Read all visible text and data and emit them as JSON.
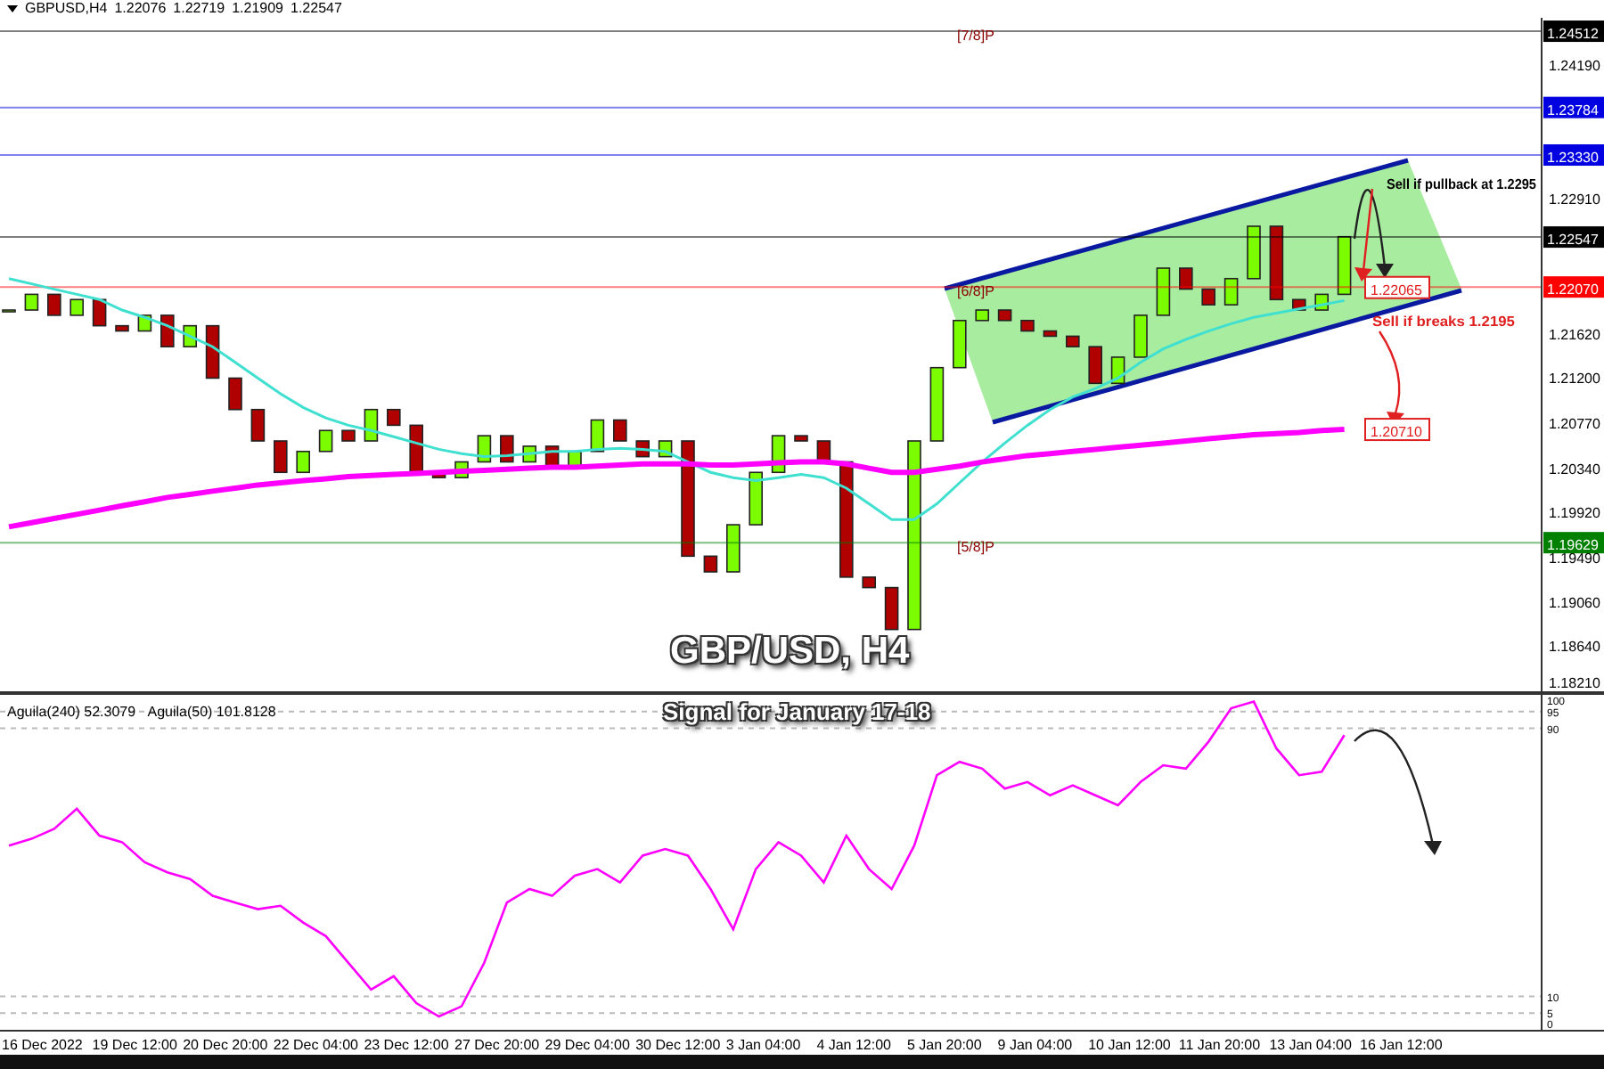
{
  "header": {
    "symbol": "GBPUSD,H4",
    "ohlc": [
      "1.22076",
      "1.22719",
      "1.21909",
      "1.22547"
    ]
  },
  "price_chart": {
    "notes": [
      {
        "text": "Sell if pullback at 1.2295",
        "color": "#000000"
      },
      {
        "text": "Sell if breaks 1.2195",
        "color": "#e02020"
      }
    ],
    "price_tags": [
      {
        "text": "1.22065",
        "color": "#e02020"
      },
      {
        "text": "1.20710",
        "color": "#e02020"
      }
    ],
    "chart_data": {
      "type": "line",
      "ylim": [
        1.1821,
        1.2464
      ],
      "yticks": [
        {
          "value": 1.2419,
          "label": "1.24190"
        },
        {
          "value": 1.2291,
          "label": "1.22910"
        },
        {
          "value": 1.2162,
          "label": "1.21620"
        },
        {
          "value": 1.212,
          "label": "1.21200"
        },
        {
          "value": 1.2077,
          "label": "1.20770"
        },
        {
          "value": 1.2034,
          "label": "1.20340"
        },
        {
          "value": 1.1992,
          "label": "1.19920"
        },
        {
          "value": 1.1949,
          "label": "1.19490"
        },
        {
          "value": 1.1906,
          "label": "1.19060"
        },
        {
          "value": 1.1864,
          "label": "1.18640"
        },
        {
          "value": 1.1821,
          "label": "1.18210"
        }
      ],
      "ref_lines": [
        {
          "axis": "y",
          "value": 1.24512,
          "label": "1.24512",
          "color": "#000000"
        },
        {
          "axis": "y",
          "value": 1.23784,
          "label": "1.23784",
          "color": "#0000e0"
        },
        {
          "axis": "y",
          "value": 1.2333,
          "label": "1.23330",
          "color": "#0000e0"
        },
        {
          "axis": "y",
          "value": 1.22547,
          "label": "1.22547",
          "color": "#000000"
        },
        {
          "axis": "y",
          "value": 1.2207,
          "label": "1.22070",
          "color": "#ff0000"
        },
        {
          "axis": "y",
          "value": 1.19629,
          "label": "1.19629",
          "color": "#008000"
        }
      ],
      "annotations": [
        {
          "text": "[7/8]P",
          "y": 1.24512
        },
        {
          "text": "[6/8]P",
          "y": 1.2207
        },
        {
          "text": "[5/8]P",
          "y": 1.19629
        }
      ],
      "series": [
        {
          "color": "#40e0d0",
          "values": [
            1.2215,
            1.221,
            1.2205,
            1.22,
            1.2195,
            1.2185,
            1.2178,
            1.217,
            1.216,
            1.215,
            1.2135,
            1.212,
            1.2105,
            1.2092,
            1.2082,
            1.2075,
            1.207,
            1.2064,
            1.2058,
            1.2052,
            1.2048,
            1.2045,
            1.2046,
            1.2048,
            1.205,
            1.205,
            1.2052,
            1.2053,
            1.2052,
            1.205,
            1.204,
            1.203,
            1.2025,
            1.2022,
            1.2025,
            1.2028,
            1.2025,
            1.2015,
            1.2,
            1.1985,
            1.1985,
            1.2,
            1.202,
            1.204,
            1.2058,
            1.2075,
            1.209,
            1.2102,
            1.211,
            1.212,
            1.2135,
            1.2148,
            1.2157,
            1.2165,
            1.2172,
            1.2178,
            1.2182,
            1.2186,
            1.219,
            1.2194
          ]
        },
        {
          "color": "#ff00ff",
          "values": [
            1.1978,
            1.1982,
            1.1986,
            1.199,
            1.1994,
            1.1998,
            1.2002,
            1.2006,
            1.2009,
            1.2012,
            1.2015,
            1.2018,
            1.202,
            1.2022,
            1.2024,
            1.2026,
            1.2027,
            1.2028,
            1.2029,
            1.203,
            1.2031,
            1.2032,
            1.2033,
            1.2034,
            1.2035,
            1.2035,
            1.2036,
            1.2037,
            1.2038,
            1.2038,
            1.2038,
            1.2037,
            1.2037,
            1.2038,
            1.2039,
            1.204,
            1.204,
            1.2038,
            1.2034,
            1.203,
            1.203,
            1.2033,
            1.2036,
            1.204,
            1.2043,
            1.2046,
            1.2048,
            1.205,
            1.2052,
            1.2054,
            1.2056,
            1.2058,
            1.206,
            1.2062,
            1.2064,
            1.2066,
            1.2067,
            1.2068,
            1.207,
            1.2071
          ]
        }
      ]
    }
  },
  "overlay_title": "GBP/USD, H4",
  "overlay_subtitle": "Signal for January 17-18",
  "indicator": {
    "legend": [
      {
        "value": "52.3079"
      },
      {
        "name": "Aguila(50)",
        "value": "101.8128"
      }
    ],
    "chart_data": {
      "type": "line",
      "ylim": [
        0,
        100
      ],
      "yticks": [
        100,
        95,
        90,
        10,
        5,
        0
      ],
      "grid": true,
      "series": [
        {
          "name": "Aguila(240)",
          "color": "#ff00ff",
          "values": [
            55,
            57,
            60,
            66,
            58,
            56,
            50,
            47,
            45,
            40,
            38,
            36,
            37,
            32,
            28,
            20,
            12,
            16,
            8,
            4,
            7,
            20,
            38,
            42,
            40,
            46,
            48,
            44,
            52,
            54,
            52,
            42,
            30,
            48,
            56,
            52,
            44,
            58,
            48,
            42,
            55,
            76,
            80,
            78,
            72,
            74,
            70,
            73,
            70,
            67,
            74,
            79,
            78,
            86,
            96,
            98,
            84,
            76,
            77,
            88
          ]
        }
      ]
    },
    "time_axis": [
      "16 Dec 2022",
      "19 Dec 12:00",
      "20 Dec 20:00",
      "22 Dec 04:00",
      "23 Dec 12:00",
      "27 Dec 20:00",
      "29 Dec 04:00",
      "30 Dec 12:00",
      "3 Jan 04:00",
      "4 Jan 12:00",
      "5 Jan 20:00",
      "9 Jan 04:00",
      "10 Jan 12:00",
      "11 Jan 20:00",
      "13 Jan 04:00",
      "16 Jan 12:00"
    ]
  }
}
